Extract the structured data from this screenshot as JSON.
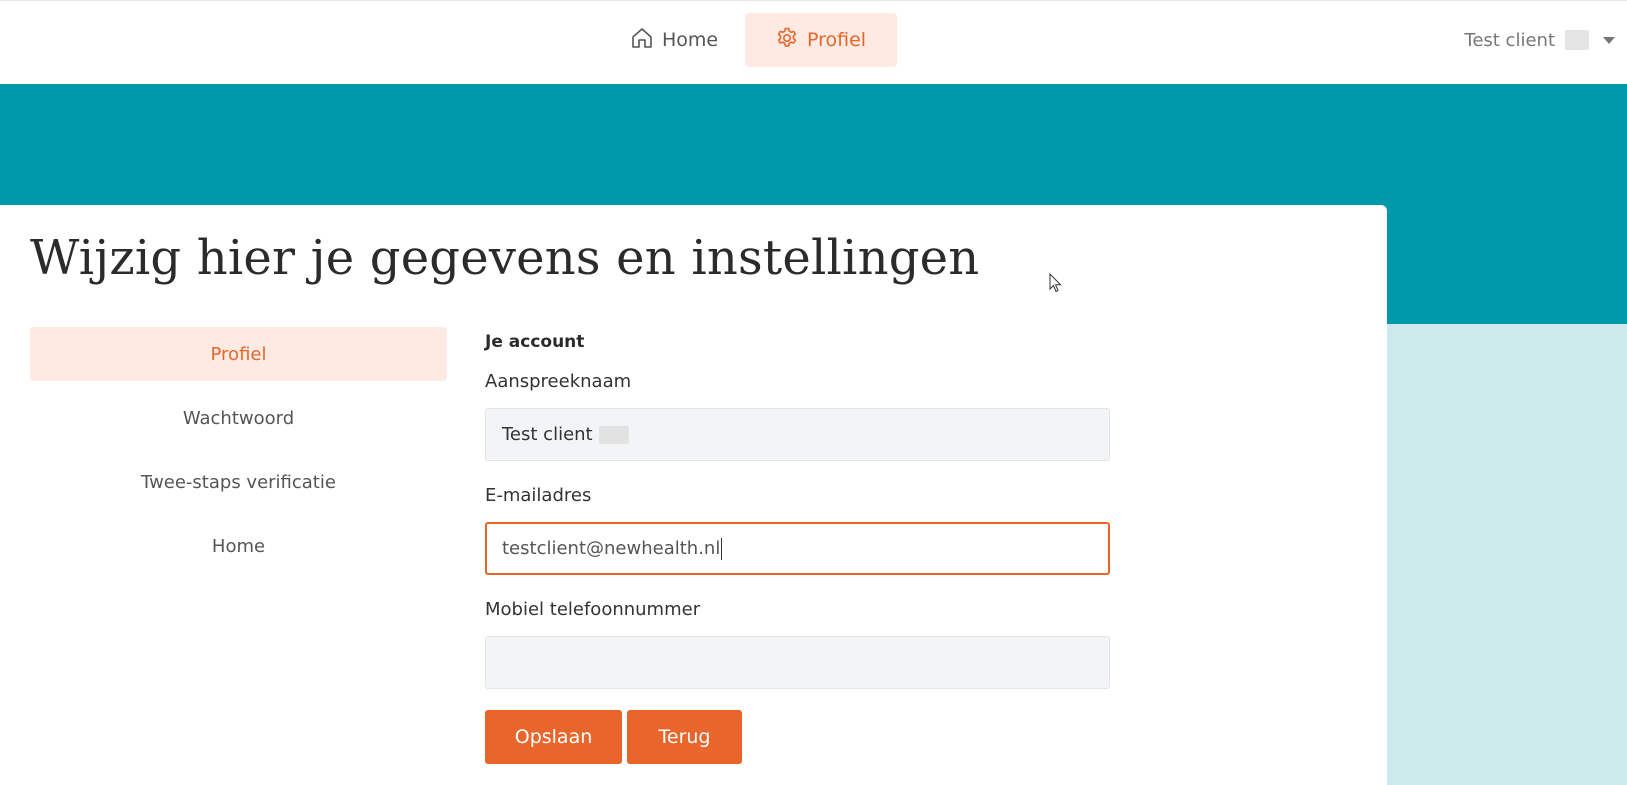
{
  "nav": {
    "home_label": "Home",
    "profiel_label": "Profiel",
    "user_name": "Test client"
  },
  "page": {
    "title": "Wijzig hier je gegevens en instellingen"
  },
  "sidebar": {
    "items": [
      {
        "label": "Profiel",
        "active": true
      },
      {
        "label": "Wachtwoord",
        "active": false
      },
      {
        "label": "Twee-staps verificatie",
        "active": false
      },
      {
        "label": "Home",
        "active": false
      }
    ]
  },
  "form": {
    "heading": "Je account",
    "name_label": "Aanspreeknaam",
    "name_value": "Test client",
    "email_label": "E-mailadres",
    "email_value": "testclient@newhealth.nl",
    "phone_label": "Mobiel telefoonnummer",
    "phone_value": "",
    "save_label": "Opslaan",
    "back_label": "Terug"
  },
  "colors": {
    "accent": "#e8662c",
    "accent_light": "#fdeae2",
    "teal": "#0099ab",
    "teal_light": "#cce9ec"
  }
}
